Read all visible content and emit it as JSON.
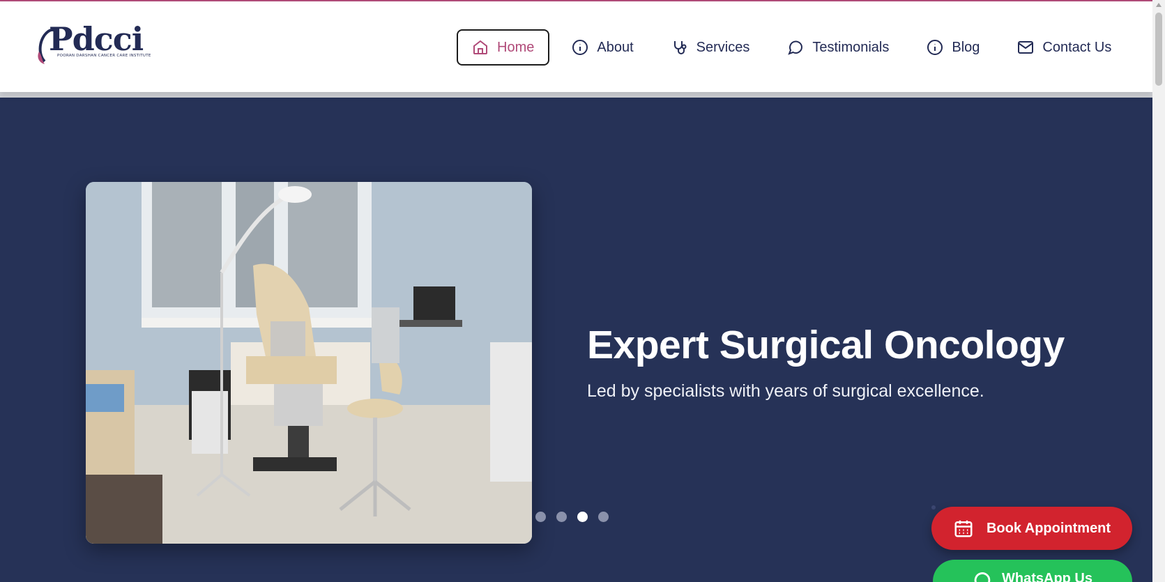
{
  "brand": {
    "logo_text": "Pdcci",
    "tagline": "POORAN DARSHAN CANCER CARE INSTITUTE"
  },
  "nav": {
    "items": [
      {
        "label": "Home",
        "icon": "home-icon",
        "active": true
      },
      {
        "label": "About",
        "icon": "info-icon"
      },
      {
        "label": "Services",
        "icon": "stethoscope-icon"
      },
      {
        "label": "Testimonials",
        "icon": "chat-bubble-icon"
      },
      {
        "label": "Blog",
        "icon": "info-icon"
      },
      {
        "label": "Contact Us",
        "icon": "mail-icon"
      }
    ]
  },
  "hero": {
    "title": "Expert Surgical Oncology",
    "subtitle": "Led by specialists with years of surgical excellence.",
    "image_subject": "gynecological examination room with exam chair, stool and laptop",
    "slides_total": 4,
    "active_slide": 3
  },
  "cta": {
    "book_label": "Book Appointment",
    "whatsapp_label": "WhatsApp Us"
  },
  "colors": {
    "brand_navy": "#232b55",
    "hero_bg": "#263257",
    "accent_pink": "#b04a78",
    "book_red": "#d2232e",
    "whatsapp_green": "#25c25a"
  }
}
